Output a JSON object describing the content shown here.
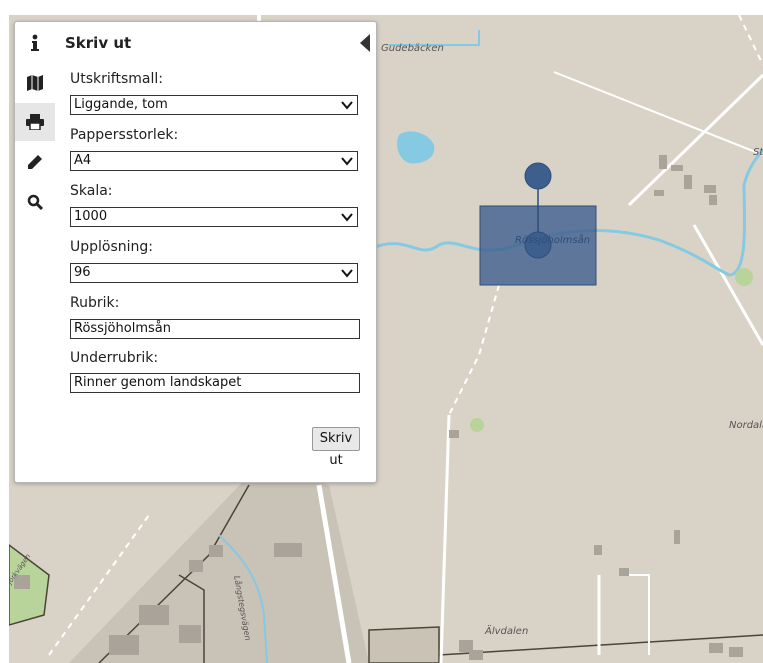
{
  "panel": {
    "title": "Skriv ut",
    "sidebar": [
      "info-icon",
      "map-icon",
      "print-icon",
      "pencil-icon",
      "search-icon"
    ],
    "fields": {
      "template_label": "Utskriftsmall:",
      "template_value": "Liggande, tom",
      "paper_label": "Pappersstorlek:",
      "paper_value": "A4",
      "scale_label": "Skala:",
      "scale_value": "1000",
      "resolution_label": "Upplösning:",
      "resolution_value": "96",
      "title_label": "Rubrik:",
      "title_value": "Rössjöholmsån",
      "subtitle_label": "Underrubrik:",
      "subtitle_value": "Rinner genom landskapet"
    },
    "print_button": "Skriv ut"
  },
  "map": {
    "labels": {
      "gudebacken": "Gudebäcken",
      "stream": "Rössjöholmsån",
      "nordala": "Nordala",
      "alvdalen": "Älvdalen",
      "langstegsvagen": "Långstegsvägen",
      "st": "St",
      "road_left": "Björkvägen"
    },
    "colors": {
      "land": "#d9d3c7",
      "water": "#86c9e2",
      "print_area": "#3d5f8e"
    }
  }
}
